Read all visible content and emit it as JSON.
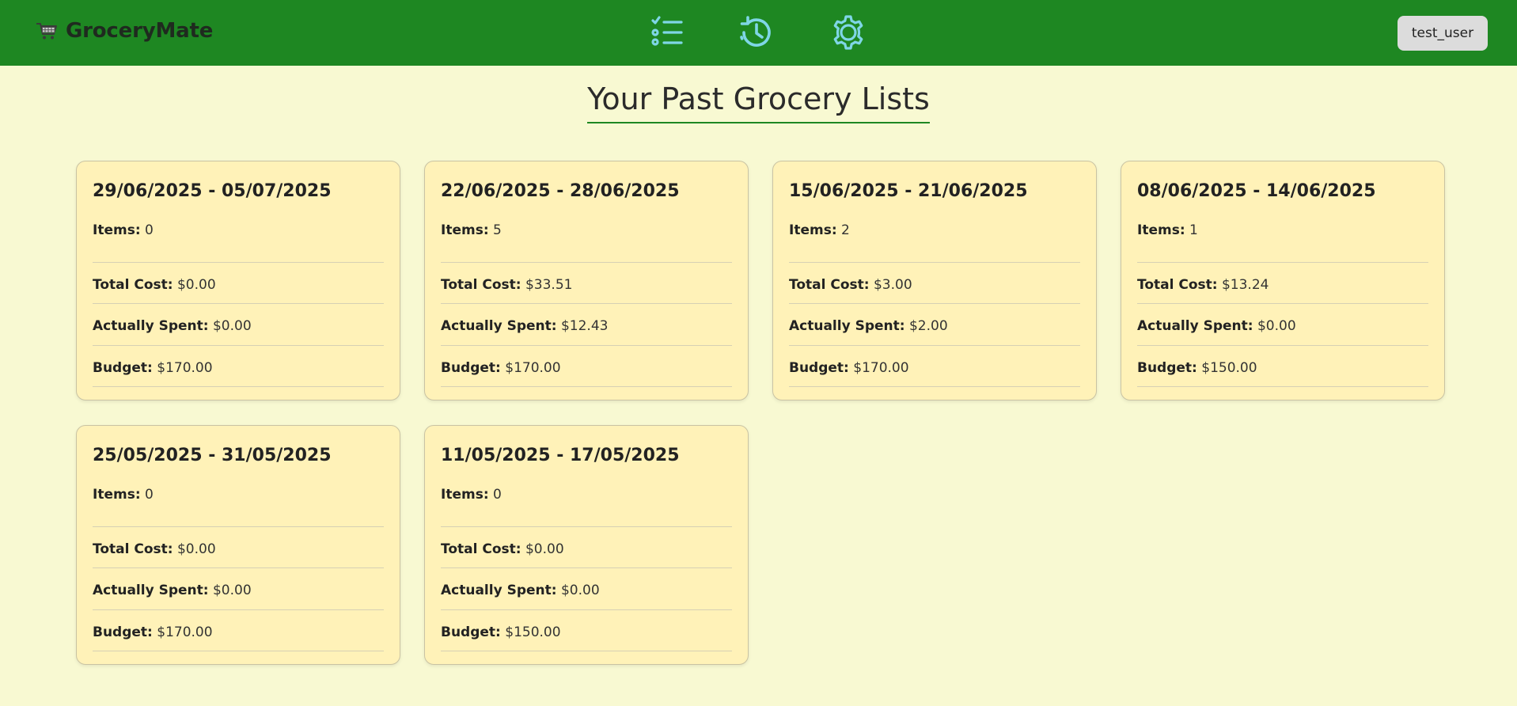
{
  "app": {
    "name": "GroceryMate",
    "user_label": "test_user",
    "nav": [
      {
        "icon": "checklist-icon"
      },
      {
        "icon": "history-icon"
      },
      {
        "icon": "settings-gear-icon"
      }
    ],
    "colors": {
      "header": "#1e8722",
      "background": "#f8f9d2",
      "card": "#fff2b8",
      "icon_accent": "#7fd6e6"
    }
  },
  "page": {
    "title": "Your Past Grocery Lists"
  },
  "lists": [
    {
      "date_range": "29/06/2025 - 05/07/2025",
      "items_label": "Items:",
      "items": "0",
      "total_label": "Total Cost:",
      "total_cost": "$0.00",
      "spent_label": "Actually Spent:",
      "spent": "$0.00",
      "budget_label": "Budget:",
      "budget": "$170.00"
    },
    {
      "date_range": "22/06/2025 - 28/06/2025",
      "items_label": "Items:",
      "items": "5",
      "total_label": "Total Cost:",
      "total_cost": "$33.51",
      "spent_label": "Actually Spent:",
      "spent": "$12.43",
      "budget_label": "Budget:",
      "budget": "$170.00"
    },
    {
      "date_range": "15/06/2025 - 21/06/2025",
      "items_label": "Items:",
      "items": "2",
      "total_label": "Total Cost:",
      "total_cost": "$3.00",
      "spent_label": "Actually Spent:",
      "spent": "$2.00",
      "budget_label": "Budget:",
      "budget": "$170.00"
    },
    {
      "date_range": "08/06/2025 - 14/06/2025",
      "items_label": "Items:",
      "items": "1",
      "total_label": "Total Cost:",
      "total_cost": "$13.24",
      "spent_label": "Actually Spent:",
      "spent": "$0.00",
      "budget_label": "Budget:",
      "budget": "$150.00"
    },
    {
      "date_range": "25/05/2025 - 31/05/2025",
      "items_label": "Items:",
      "items": "0",
      "total_label": "Total Cost:",
      "total_cost": "$0.00",
      "spent_label": "Actually Spent:",
      "spent": "$0.00",
      "budget_label": "Budget:",
      "budget": "$170.00"
    },
    {
      "date_range": "11/05/2025 - 17/05/2025",
      "items_label": "Items:",
      "items": "0",
      "total_label": "Total Cost:",
      "total_cost": "$0.00",
      "spent_label": "Actually Spent:",
      "spent": "$0.00",
      "budget_label": "Budget:",
      "budget": "$150.00"
    }
  ]
}
